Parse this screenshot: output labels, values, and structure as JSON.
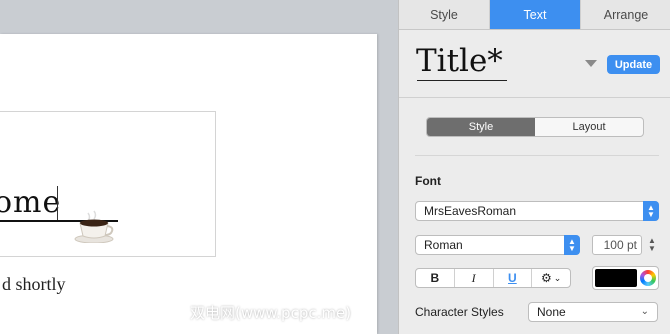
{
  "document": {
    "title_fragment": "ome",
    "subline": "d shortly",
    "cup_emoji": "☕"
  },
  "watermark": "双电网(www.pcpc.me)",
  "inspector": {
    "tabs": [
      {
        "label": "Style",
        "active": false
      },
      {
        "label": "Text",
        "active": true
      },
      {
        "label": "Arrange",
        "active": false
      }
    ],
    "paragraph_style": {
      "name": "Title*",
      "update_label": "Update"
    },
    "sub_tabs": [
      {
        "label": "Style",
        "active": true
      },
      {
        "label": "Layout",
        "active": false
      }
    ],
    "font": {
      "section_label": "Font",
      "family": "MrsEavesRoman",
      "typeface": "Roman",
      "size": "100 pt"
    },
    "format_buttons": {
      "bold": "B",
      "italic": "I",
      "underline": "U",
      "gear": "⚙"
    },
    "text_color": "#000000",
    "character_styles": {
      "label": "Character Styles",
      "value": "None"
    }
  },
  "colors": {
    "accent": "#3d8ff0",
    "canvas_bg": "#c9cdd2",
    "inspector_bg": "#ececec"
  }
}
